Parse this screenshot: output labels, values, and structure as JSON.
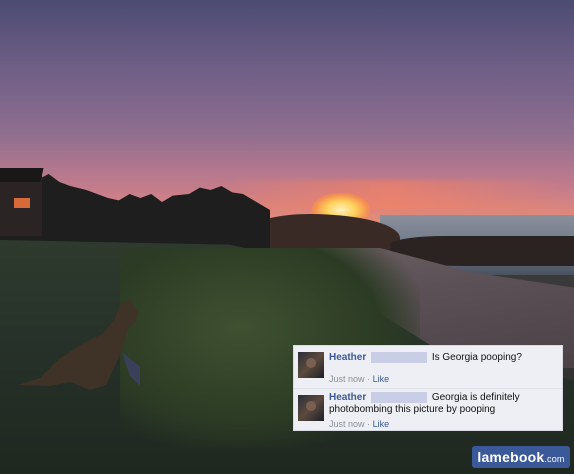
{
  "comments": [
    {
      "name": "Heather",
      "text": "Is Georgia pooping?",
      "time": "Just now",
      "sep": "·",
      "like": "Like"
    },
    {
      "name": "Heather",
      "text": "Georgia is definitely photobombing this picture by pooping",
      "time": "Just now",
      "sep": "·",
      "like": "Like"
    }
  ],
  "watermark": {
    "main": "lamebook",
    "suffix": ".com"
  }
}
